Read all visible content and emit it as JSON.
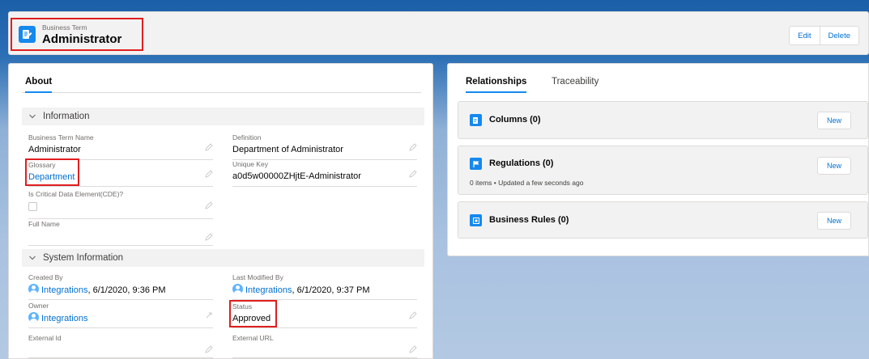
{
  "header": {
    "object_type": "Business Term",
    "record_name": "Administrator",
    "edit_label": "Edit",
    "delete_label": "Delete"
  },
  "left": {
    "tab_about": "About",
    "info_section": "Information",
    "fields": {
      "term_name_label": "Business Term Name",
      "term_name_value": "Administrator",
      "definition_label": "Definition",
      "definition_value": "Department of Administrator",
      "glossary_label": "Glossary",
      "glossary_value": "Department",
      "unique_key_label": "Unique Key",
      "unique_key_value": "a0d5w00000ZHjtE-Administrator",
      "cde_label": "Is Critical Data Element(CDE)?",
      "full_name_label": "Full Name"
    },
    "system_section": "System Information",
    "system": {
      "created_by_label": "Created By",
      "created_by_user": "Integrations",
      "created_by_date": ", 6/1/2020, 9:36 PM",
      "modified_by_label": "Last Modified By",
      "modified_by_user": "Integrations",
      "modified_by_date": ", 6/1/2020, 9:37 PM",
      "owner_label": "Owner",
      "owner_value": "Integrations",
      "status_label": "Status",
      "status_value": "Approved",
      "external_id_label": "External Id",
      "external_url_label": "External URL"
    }
  },
  "right": {
    "tab_relationships": "Relationships",
    "tab_traceability": "Traceability",
    "cards": {
      "columns_title": "Columns (0)",
      "regulations_title": "Regulations (0)",
      "regulations_sub": "0 items • Updated a few seconds ago",
      "rules_title": "Business Rules (0)",
      "new_label": "New"
    }
  },
  "colors": {
    "brand_blue": "#1589ee",
    "link_blue": "#0070d2",
    "highlight_red": "#e01e1e"
  }
}
